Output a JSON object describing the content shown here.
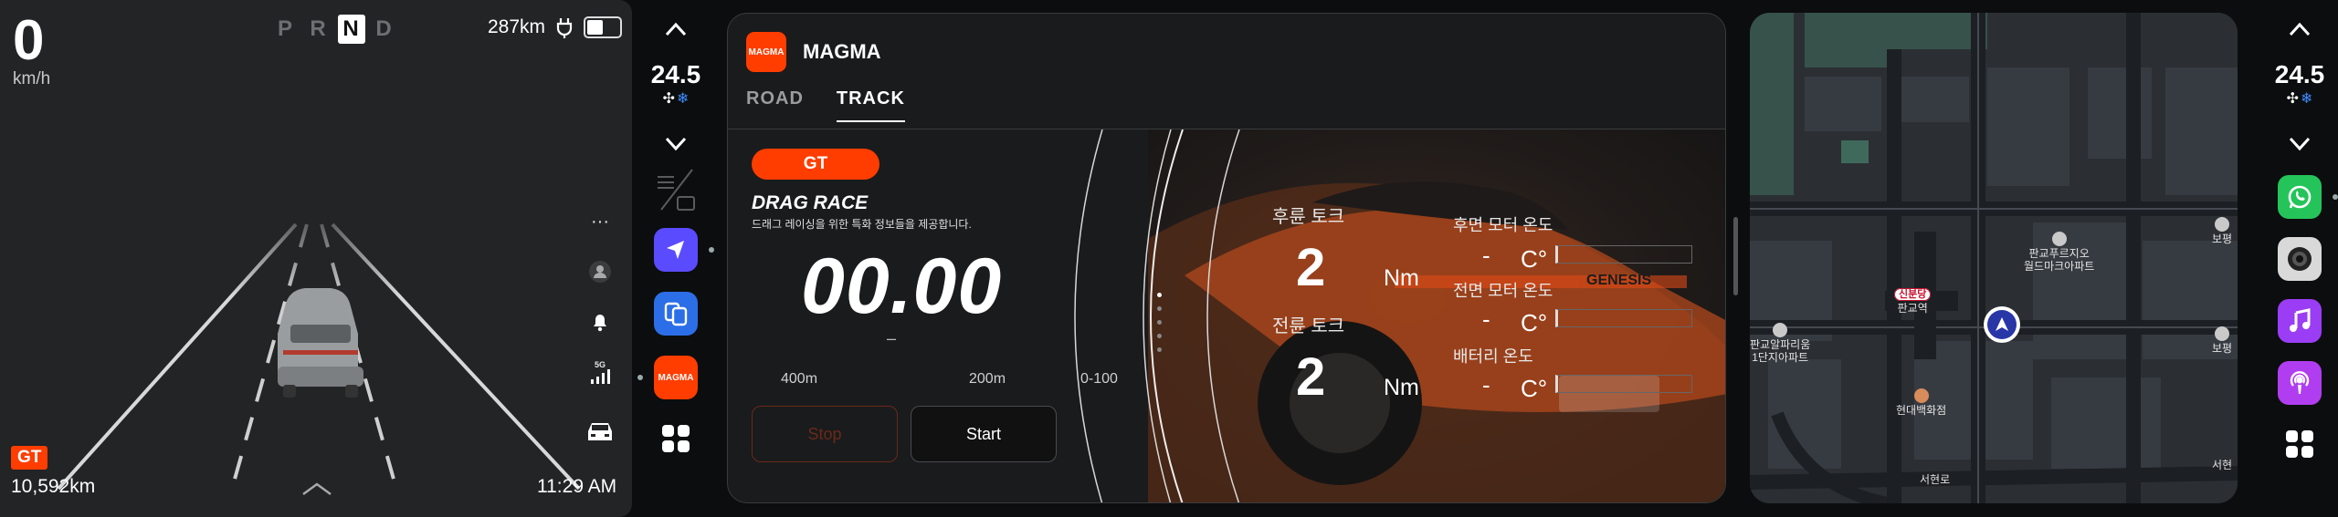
{
  "cluster": {
    "speed": "0",
    "speed_unit": "km/h",
    "gears": [
      "P",
      "R",
      "N",
      "D"
    ],
    "active_gear": "N",
    "range": "287km",
    "badge": "GT",
    "odometer": "10,592km",
    "time": "11:29 AM",
    "signal_label": "5G"
  },
  "climate_left": {
    "temp": "24.5"
  },
  "climate_right": {
    "temp": "24.5"
  },
  "apps_left": [
    {
      "name": "navigation",
      "color": "#5b4bff"
    },
    {
      "name": "connect",
      "color": "#2b6ee8"
    },
    {
      "name": "MAGMA",
      "color": "#ff3d00"
    }
  ],
  "apps_right": [
    {
      "name": "whatsapp",
      "color": "#25c45a"
    },
    {
      "name": "camera",
      "color": "#d9d9d9"
    },
    {
      "name": "music",
      "color": "#9b3df5"
    },
    {
      "name": "podcasts",
      "color": "#b13df0"
    }
  ],
  "magma": {
    "logo_text": "MAGMA",
    "title": "MAGMA",
    "tabs": [
      "ROAD",
      "TRACK"
    ],
    "active_tab": "TRACK",
    "mode_pill": "GT",
    "drag_title": "DRAG RACE",
    "drag_subtitle": "드래그 레이싱을 위한 특화 정보들을 제공합니다.",
    "timer": "00.00",
    "timer_sub": "–",
    "distances": [
      "400m",
      "200m",
      "0-100"
    ],
    "stop_label": "Stop",
    "start_label": "Start",
    "rear_torque_label": "후륜 토크",
    "rear_torque_value": "2",
    "front_torque_label": "전륜 토크",
    "front_torque_value": "2",
    "torque_unit": "Nm",
    "rear_motor_temp_label": "후면 모터 온도",
    "front_motor_temp_label": "전면 모터 온도",
    "battery_temp_label": "배터리 온도",
    "temp_value": "-",
    "temp_unit": "C°"
  },
  "map": {
    "station": "신분당",
    "poi_pangyo_station": "판교역",
    "poi_alphadom": "판교알파리움\n1단지아파트",
    "poi_hyundai": "현대백화점",
    "poi_prugio": "판교푸르지오\n월드마크아파트",
    "poi_bo1": "보평",
    "poi_bo2": "보평",
    "road_seohyeon": "서현로",
    "road_seo": "서현"
  }
}
